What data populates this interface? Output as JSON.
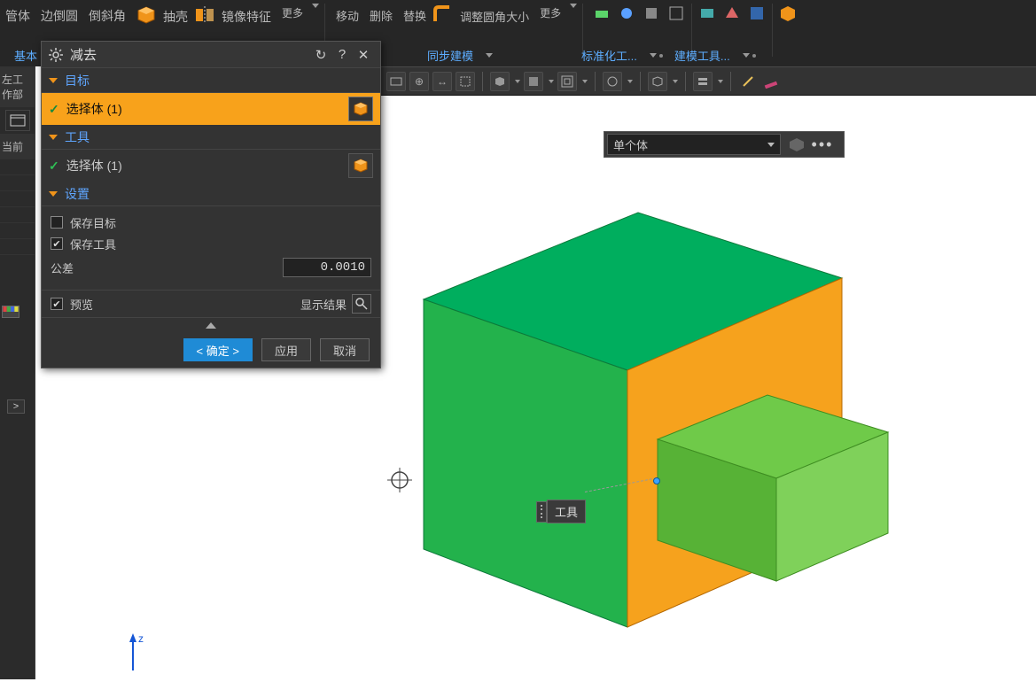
{
  "ribbon": {
    "items": [
      "管体",
      "边倒圆",
      "倒斜角",
      "抽壳",
      "镜像特征"
    ],
    "more1": "更多",
    "grp2": [
      "移动",
      "删除",
      "替换",
      "调整圆角大小"
    ],
    "more2": "更多",
    "tab_base": "基本",
    "tab_sync": "同步建模",
    "tab_std": "标准化工...",
    "tab_tool": "建模工具..."
  },
  "leftbar": {
    "label": "左工作部",
    "current": "当前"
  },
  "dialog": {
    "title": "减去",
    "section_target": "目标",
    "section_tool": "工具",
    "section_settings": "设置",
    "select_body": "选择体 (1)",
    "chk_save_target": "保存目标",
    "chk_save_tool": "保存工具",
    "tolerance_label": "公差",
    "tolerance_value": "0.0010",
    "preview": "预览",
    "show_result": "显示结果",
    "ok": "< 确定 >",
    "apply": "应用",
    "cancel": "取消"
  },
  "floatbar": {
    "value": "单个体"
  },
  "annotation": {
    "label": "工具"
  },
  "axis": {
    "z": "z"
  }
}
